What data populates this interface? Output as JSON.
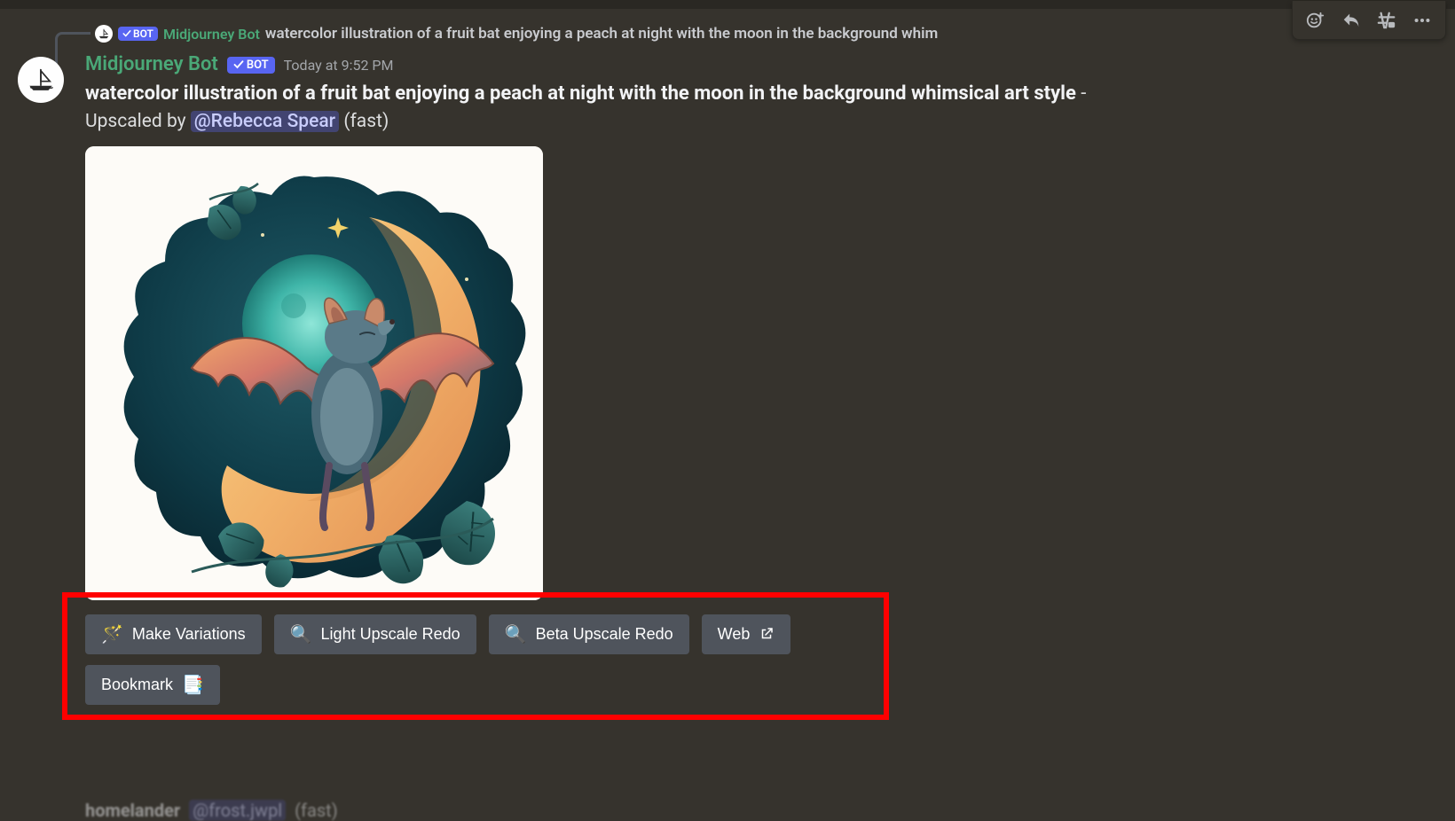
{
  "toolbar": {
    "add_reaction": "add-reaction",
    "reply": "reply",
    "create_thread": "create-thread",
    "more": "more"
  },
  "reply_ref": {
    "bot_tag": "BOT",
    "author": "Midjourney Bot",
    "preview": "watercolor illustration of a fruit bat enjoying a peach at night with the moon in the background whim"
  },
  "message": {
    "author": "Midjourney Bot",
    "bot_tag": "BOT",
    "timestamp": "Today at 9:52 PM",
    "prompt": "watercolor illustration of a fruit bat enjoying a peach at night with the moon in the background whimsical art style",
    "dash": " - ",
    "upscaled_prefix": "Upscaled by ",
    "mention": "@Rebecca Spear",
    "upscaled_suffix": " (fast)"
  },
  "buttons": {
    "row1": [
      {
        "emoji": "🪄",
        "label": "Make Variations"
      },
      {
        "emoji": "🔍",
        "label": "Light Upscale Redo"
      },
      {
        "emoji": "🔍",
        "label": "Beta Upscale Redo"
      },
      {
        "emoji": "",
        "label": "Web",
        "external": true
      }
    ],
    "row2": [
      {
        "emoji": "📑",
        "label": "Bookmark",
        "emoji_after": true
      }
    ]
  },
  "next_message": {
    "author": "homelander",
    "mention": "@frost.jwpl",
    "text": "(fast)"
  },
  "colors": {
    "bg": "#36332d",
    "accent": "#5865f2",
    "author_green": "#4aa877",
    "button_bg": "#4f545c",
    "highlight": "#ff0000"
  }
}
